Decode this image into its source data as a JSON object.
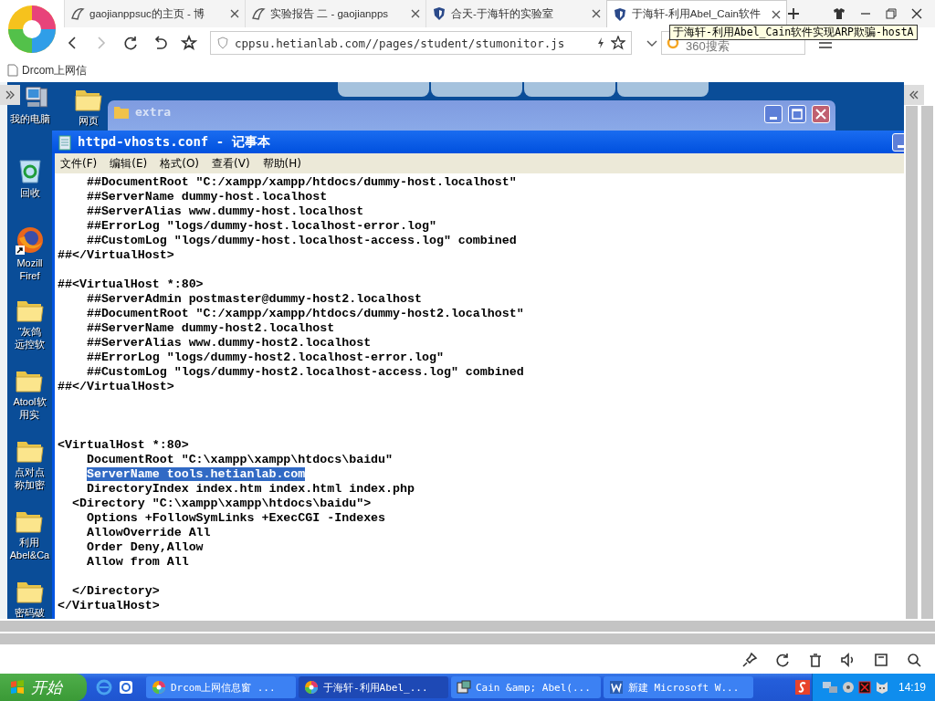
{
  "browser": {
    "tabs": [
      {
        "title": "gaojianppsuc的主页 - 博",
        "kind": "blog",
        "selected": false
      },
      {
        "title": "实验报告 二 - gaojianpps",
        "kind": "blog",
        "selected": false
      },
      {
        "title": "合天-于海轩的实验室",
        "kind": "shield",
        "selected": false
      },
      {
        "title": "于海轩-利用Abel_Cain软件",
        "kind": "shield",
        "selected": true
      }
    ],
    "address": "cppsu.hetianlab.com//pages/student/stumonitor.js",
    "search": {
      "placeholder": "360搜索"
    },
    "tooltip": "于海轩-利用Abel_Cain软件实现ARP欺骗-hostA",
    "bookmarks": [
      {
        "label": "Drcom上网信"
      }
    ]
  },
  "desktop": {
    "icons": [
      {
        "kind": "computer",
        "lines": [
          "我的电脑"
        ]
      },
      {
        "kind": "recycle",
        "lines": [
          "回收"
        ]
      },
      {
        "kind": "firefox",
        "lines": [
          "Mozill",
          "Firef"
        ]
      },
      {
        "kind": "folder",
        "lines": [
          "“灰鸽",
          "远控软"
        ]
      },
      {
        "kind": "folder",
        "lines": [
          "Atool软",
          "用实"
        ]
      },
      {
        "kind": "folder",
        "lines": [
          "点对点",
          "称加密"
        ]
      },
      {
        "kind": "folder",
        "lines": [
          "利用",
          "Abel&Ca"
        ]
      },
      {
        "kind": "folder",
        "lines": [
          "密码破"
        ]
      }
    ],
    "second_icon": {
      "kind": "folder",
      "lines": [
        "网页"
      ]
    }
  },
  "explorer_window": {
    "title": "extra"
  },
  "notepad": {
    "title": "httpd-vhosts.conf - 记事本",
    "menu": [
      "文件(F)",
      "编辑(E)",
      "格式(O)",
      "查看(V)",
      "帮助(H)"
    ],
    "lines": [
      {
        "kind": "text",
        "text": "    ##DocumentRoot \"C:/xampp/xampp/htdocs/dummy-host.localhost\"",
        "selected": false
      },
      {
        "kind": "text",
        "text": "    ##ServerName dummy-host.localhost",
        "selected": false
      },
      {
        "kind": "text",
        "text": "    ##ServerAlias www.dummy-host.localhost",
        "selected": false
      },
      {
        "kind": "text",
        "text": "    ##ErrorLog \"logs/dummy-host.localhost-error.log\"",
        "selected": false
      },
      {
        "kind": "text",
        "text": "    ##CustomLog \"logs/dummy-host.localhost-access.log\" combined",
        "selected": false
      },
      {
        "kind": "text",
        "text": "##</VirtualHost>",
        "selected": false
      },
      {
        "kind": "blank"
      },
      {
        "kind": "text",
        "text": "##<VirtualHost *:80>",
        "selected": false
      },
      {
        "kind": "text",
        "text": "    ##ServerAdmin postmaster@dummy-host2.localhost",
        "selected": false
      },
      {
        "kind": "text",
        "text": "    ##DocumentRoot \"C:/xampp/xampp/htdocs/dummy-host2.localhost\"",
        "selected": false
      },
      {
        "kind": "text",
        "text": "    ##ServerName dummy-host2.localhost",
        "selected": false
      },
      {
        "kind": "text",
        "text": "    ##ServerAlias www.dummy-host2.localhost",
        "selected": false
      },
      {
        "kind": "text",
        "text": "    ##ErrorLog \"logs/dummy-host2.localhost-error.log\"",
        "selected": false
      },
      {
        "kind": "text",
        "text": "    ##CustomLog \"logs/dummy-host2.localhost-access.log\" combined",
        "selected": false
      },
      {
        "kind": "text",
        "text": "##</VirtualHost>",
        "selected": false
      },
      {
        "kind": "blank"
      },
      {
        "kind": "blank"
      },
      {
        "kind": "blank"
      },
      {
        "kind": "text",
        "text": "<VirtualHost *:80>",
        "selected": false
      },
      {
        "kind": "text",
        "text": "    DocumentRoot \"C:\\xampp\\xampp\\htdocs\\baidu\"",
        "selected": false
      },
      {
        "kind": "text",
        "text": "    ServerName tools.hetianlab.com",
        "selected": true
      },
      {
        "kind": "text",
        "text": "    DirectoryIndex index.htm index.html index.php",
        "selected": false
      },
      {
        "kind": "text",
        "text": "  <Directory \"C:\\xampp\\xampp\\htdocs\\baidu\">",
        "selected": false
      },
      {
        "kind": "text",
        "text": "    Options +FollowSymLinks +ExecCGI -Indexes",
        "selected": false
      },
      {
        "kind": "text",
        "text": "    AllowOverride All",
        "selected": false
      },
      {
        "kind": "text",
        "text": "    Order Deny,Allow",
        "selected": false
      },
      {
        "kind": "text",
        "text": "    Allow from All",
        "selected": false
      },
      {
        "kind": "blank"
      },
      {
        "kind": "text",
        "text": "  </Directory>",
        "selected": false
      },
      {
        "kind": "text",
        "text": "</VirtualHost>",
        "selected": false
      }
    ]
  },
  "taskbar": {
    "start": "开始",
    "tasks": [
      {
        "label": "Drcom上网信息窗 ...",
        "kind": "browser",
        "selected": false
      },
      {
        "label": "于海轩-利用Abel_...",
        "kind": "browser",
        "selected": true
      },
      {
        "label": "Cain &amp; Abel(...",
        "kind": "app",
        "selected": false
      },
      {
        "label": "新建 Microsoft W...",
        "kind": "word",
        "selected": false
      }
    ],
    "clock": "14:19"
  }
}
